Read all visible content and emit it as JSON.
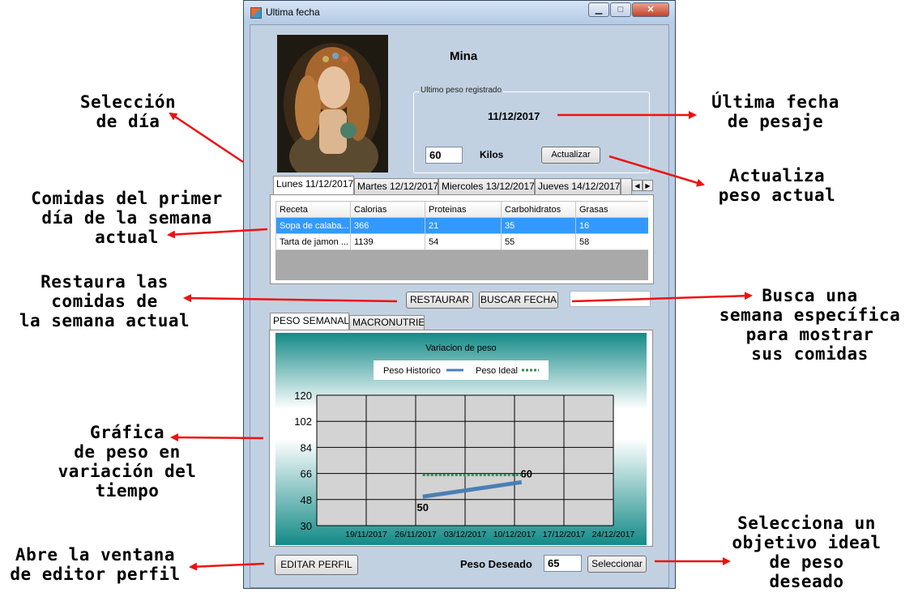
{
  "window": {
    "title": "Ultima fecha",
    "controls": {
      "minimize": "▁",
      "maximize": "□",
      "close": "✕"
    }
  },
  "profile": {
    "name": "Mina",
    "last_weight_group": "Ultimo peso registrado",
    "last_date": "11/12/2017",
    "weight_value": "60",
    "weight_unit": "Kilos",
    "update_button": "Actualizar"
  },
  "day_tabs": {
    "tabs": [
      "Lunes 11/12/2017",
      "Martes 12/12/2017",
      "Miercoles 13/12/2017",
      "Jueves 14/12/2017"
    ],
    "selected_index": 0
  },
  "meals_table": {
    "columns": [
      "Receta",
      "Calorias",
      "Proteinas",
      "Carbohidratos",
      "Grasas"
    ],
    "rows": [
      [
        "Sopa de calaba...",
        "366",
        "21",
        "35",
        "16"
      ],
      [
        "Tarta de jamon ...",
        "1139",
        "54",
        "55",
        "58"
      ]
    ],
    "selected_row": 0
  },
  "actions": {
    "restore_button": "RESTAURAR",
    "search_button": "BUSCAR FECHA",
    "search_value": ""
  },
  "chart_tabs": [
    "PESO SEMANAL",
    "MACRONUTRIENT"
  ],
  "chart_data": {
    "type": "line",
    "title": "Variacion de peso",
    "x_categories": [
      "19/11/2017",
      "26/11/2017",
      "03/12/2017",
      "10/12/2017",
      "17/12/2017",
      "24/12/2017"
    ],
    "ylim": [
      30,
      120
    ],
    "yticks": [
      30,
      48,
      66,
      84,
      102,
      120
    ],
    "legend_placement": "top-center",
    "series": [
      {
        "name": "Peso Historico",
        "style": "solid",
        "color": "#4a7fb5",
        "points": [
          {
            "x": "27/11/2017",
            "y": 50
          },
          {
            "x": "11/12/2017",
            "y": 60
          }
        ],
        "labels": [
          "50",
          "60"
        ]
      },
      {
        "name": "Peso Ideal",
        "style": "dotted",
        "color": "#2e8b57",
        "points": [
          {
            "x": "27/11/2017",
            "y": 65
          },
          {
            "x": "11/12/2017",
            "y": 65
          }
        ]
      }
    ],
    "grid": true
  },
  "bottom": {
    "edit_profile_button": "EDITAR PERFIL",
    "target_label": "Peso Deseado",
    "target_value": "65",
    "select_button": "Seleccionar"
  },
  "annotations": {
    "day_select": [
      "Selección",
      "de día"
    ],
    "first_day_meals": [
      "Comidas del primer",
      "día de la semana",
      "actual"
    ],
    "restore": [
      "Restaura las",
      "comidas de",
      "la semana actual"
    ],
    "chart": [
      "Gráfica",
      "de peso en",
      "variación del",
      "tiempo"
    ],
    "editor": [
      "Abre la ventana",
      "de editor perfil"
    ],
    "last_date": [
      "Última fecha",
      "de pesaje"
    ],
    "update_weight": [
      "Actualiza",
      "peso actual"
    ],
    "search_week": [
      "Busca una",
      "semana específica",
      "para mostrar",
      "sus comidas"
    ],
    "target": [
      "Selecciona un",
      "objetivo ideal",
      "de peso",
      "deseado"
    ]
  },
  "colors": {
    "arrow": "#ee1111",
    "window_bg": "#c2d1e1",
    "selected_row": "#3399ff"
  }
}
